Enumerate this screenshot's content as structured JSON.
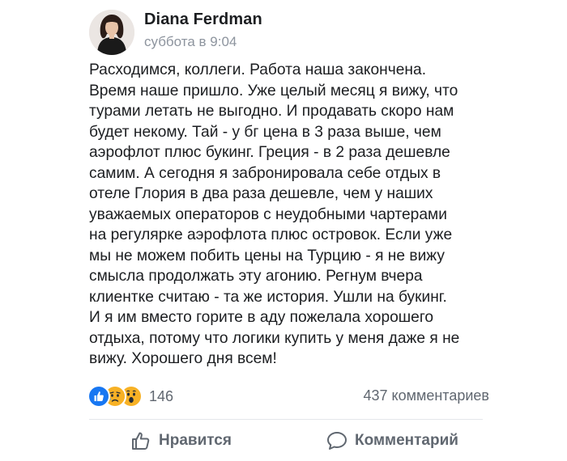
{
  "post": {
    "author": "Diana Ferdman",
    "timestamp": "суббота в 9:04",
    "text_lines": [
      "Расходимся, коллеги. Работа наша закончена.",
      "Время наше пришло. Уже целый месяц я вижу, что",
      "турами летать не выгодно. И продавать скоро нам",
      "будет некому. Тай - у бг цена в 3 раза выше, чем",
      "аэрофлот плюс букинг. Греция - в 2 раза дешевле",
      "самим. А сегодня я забронировала себе отдых в",
      "отеле Глория в два раза дешевле, чем у наших",
      "уважаемых операторов с неудобными чартерами",
      "на регулярке аэрофлота плюс островок. Если уже",
      "мы не можем побить цены на Турцию - я не вижу",
      "смысла продолжать эту агонию. Регнум вчера",
      "клиентке  считаю - та же история. Ушли на букинг.",
      "И я им вместо горите в аду пожелала хорошего",
      "отдыха, потому что логики купить у меня даже я не",
      "вижу. Хорошего дня  всем!"
    ],
    "reactions": {
      "icons": [
        "like-icon",
        "sad-icon",
        "wow-icon"
      ],
      "count": "146"
    },
    "comments_count": "437 комментариев"
  },
  "actions": {
    "like_label": "Нравится",
    "comment_label": "Комментарий"
  },
  "colors": {
    "text": "#1c1e21",
    "muted": "#606770",
    "timestamp": "#8d949e",
    "like_blue": "#1877f2",
    "emoji_yellow": "#f7b125"
  }
}
